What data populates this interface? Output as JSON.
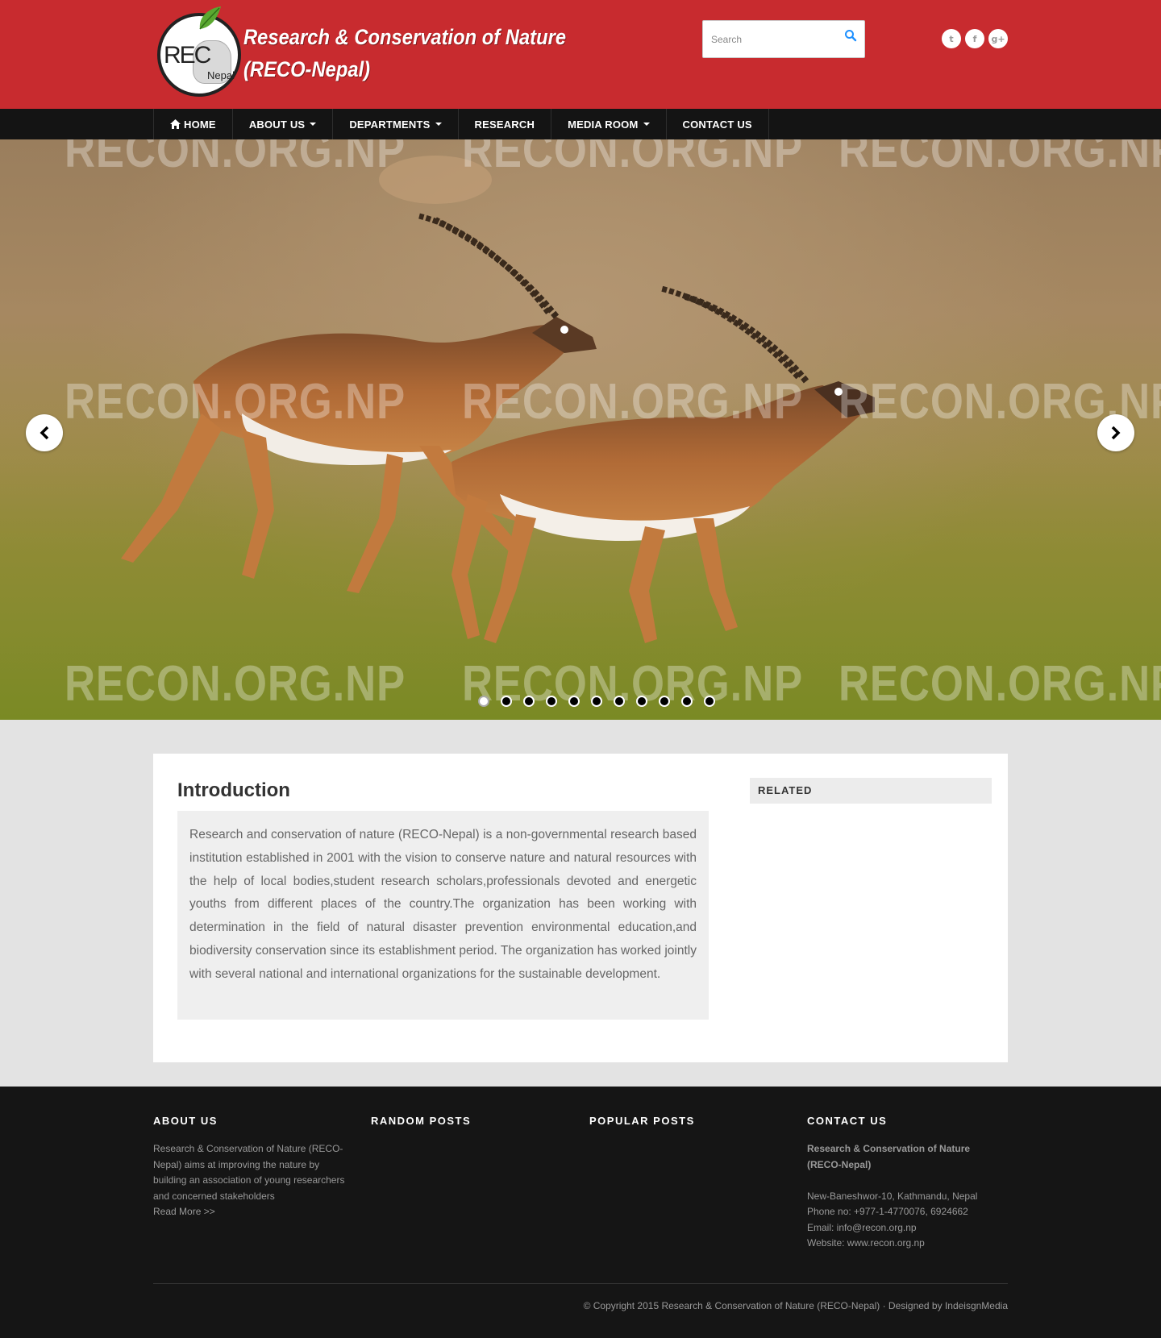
{
  "header": {
    "logo_title_line1": "Research & Conservation of Nature",
    "logo_title_line2": "(RECO-Nepal)",
    "logo_rec": "REC",
    "logo_nepal": "Nepal",
    "search_placeholder": "Search",
    "social": [
      "twitter-icon",
      "facebook-icon",
      "google-plus-icon"
    ]
  },
  "nav": {
    "items": [
      {
        "label": "HOME",
        "icon": "home-icon",
        "dropdown": false
      },
      {
        "label": "ABOUT US",
        "dropdown": true
      },
      {
        "label": "DEPARTMENTS",
        "dropdown": true
      },
      {
        "label": "RESEARCH",
        "dropdown": false
      },
      {
        "label": "MEDIA ROOM",
        "dropdown": true
      },
      {
        "label": "CONTACT US",
        "dropdown": false
      }
    ]
  },
  "slider": {
    "watermark": "RECON.ORG.NP",
    "slide_count": 11,
    "active_slide": 1
  },
  "intro": {
    "title": "Introduction",
    "body": "Research and conservation of nature (RECO-Nepal) is a non-governmental research based institution established in 2001 with the vision to conserve nature and natural resources with the help of local bodies,student research scholars,professionals devoted and energetic youths from different places of the country.The organization has been working with determination in the field of natural disaster prevention environmental education,and biodiversity conservation since its establishment period. The organization has worked jointly with several national and international organizations for the sustainable development."
  },
  "sidebar": {
    "related_title": "RELATED"
  },
  "footer": {
    "about": {
      "title": "ABOUT US",
      "text": "Research & Conservation of Nature (RECO-Nepal) aims at improving the nature by building an association of young researchers and concerned stakeholders",
      "read_more": "Read More >>"
    },
    "random_posts_title": "RANDOM POSTS",
    "popular_posts_title": "POPULAR POSTS",
    "contact": {
      "title": "CONTACT US",
      "org_name": "Research & Conservation of Nature (RECO-Nepal)",
      "address": "New-Baneshwor-10, Kathmandu, Nepal",
      "phone": "Phone no: +977-1-4770076, 6924662",
      "email": "Email: info@recon.org.np",
      "website": "Website: www.recon.org.np"
    },
    "copyright": "© Copyright 2015 Research & Conservation of Nature (RECO-Nepal) · Designed by IndeisgnMedia"
  },
  "colors": {
    "header_bg": "#c82b2f",
    "nav_bg": "#141414",
    "footer_bg": "#151515",
    "page_bg": "#e3e3e3",
    "search_icon": "#1e90ff"
  }
}
